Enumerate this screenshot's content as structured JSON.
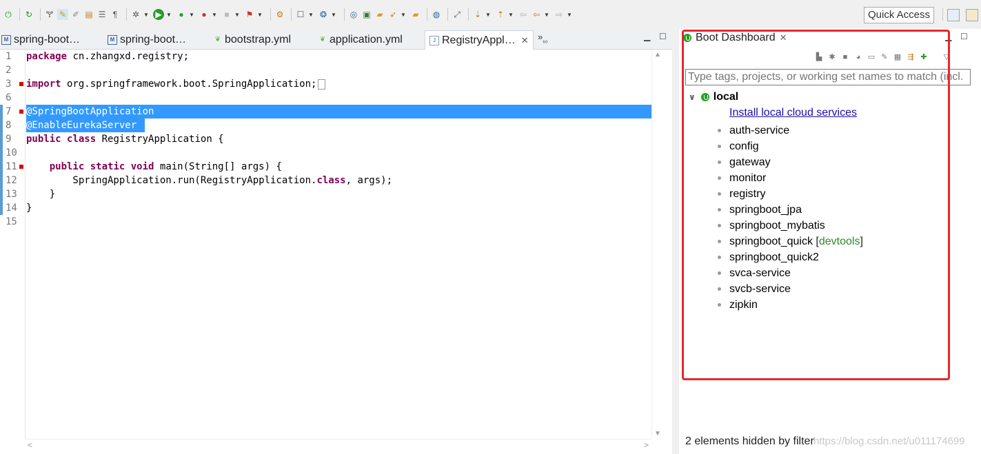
{
  "toolbar": {
    "icons": [
      "spring-boot-icon",
      "new-icon",
      "link-icon",
      "pen-icon",
      "edit-icon",
      "doc-icon",
      "pilcrow-icon",
      "debug-icon",
      "run-icon",
      "coverage-icon",
      "external-tools-icon",
      "stop-icon",
      "stop-red-icon",
      "open-type-icon",
      "new-java-icon",
      "new-class-icon",
      "browse-icon",
      "open-folder-icon",
      "rocket-icon",
      "folder-open-icon",
      "globe-icon",
      "search-icon",
      "next-annotation-icon",
      "prev-annotation-icon",
      "back-icon",
      "forward-icon"
    ],
    "quick_access": "Quick Access"
  },
  "editor_tabs": [
    {
      "label": "spring-boot…",
      "icon": "maven-pom-icon"
    },
    {
      "label": "spring-boot…",
      "icon": "maven-pom-icon"
    },
    {
      "label": "bootstrap.yml",
      "icon": "yaml-leaf-icon"
    },
    {
      "label": "application.yml",
      "icon": "yaml-leaf-icon"
    },
    {
      "label": "RegistryAppl…",
      "icon": "java-file-icon",
      "close": "✕"
    }
  ],
  "editor_overflow": "»",
  "editor_overflow_count": "₆₀",
  "code": {
    "line_numbers": [
      "1",
      "2",
      "3",
      "6",
      "7",
      "8",
      "9",
      "10",
      "11",
      "12",
      "13",
      "14",
      "15"
    ],
    "line1_kw": "package",
    "line1_rest": " cn.zhangxd.registry;",
    "line3_kw": "import",
    "line3_rest": " org.springframework.boot.SpringApplication;",
    "line7": "@SpringBootApplication",
    "line8": "@EnableEurekaServer",
    "line9_kw1": "public",
    "line9_kw2": "class",
    "line9_rest": " RegistryApplication {",
    "line11_indent": "    ",
    "line11_kw1": "public",
    "line11_kw2": "static",
    "line11_kw3": "void",
    "line11_rest": " main(String[] args) {",
    "line12_pre": "        SpringApplication.run(RegistryApplication.",
    "line12_kw": "class",
    "line12_post": ", args);",
    "line13": "    }",
    "line14": "}"
  },
  "dashboard": {
    "title": "Boot Dashboard",
    "close": "✕",
    "filter_placeholder": "Type tags, projects, or working set names to match (incl.",
    "root": "local",
    "install_link": "Install local cloud services",
    "apps": [
      {
        "name": "auth-service"
      },
      {
        "name": "config"
      },
      {
        "name": "gateway"
      },
      {
        "name": "monitor"
      },
      {
        "name": "registry"
      },
      {
        "name": "springboot_jpa"
      },
      {
        "name": "springboot_mybatis"
      },
      {
        "name": "springboot_quick",
        "tag": "devtools"
      },
      {
        "name": "springboot_quick2"
      },
      {
        "name": "svca-service"
      },
      {
        "name": "svcb-service"
      },
      {
        "name": "zipkin"
      }
    ],
    "hidden_note": "2 elements hidden by filter",
    "tools": [
      "start-icon",
      "debug-start-icon",
      "stop-icon",
      "open-browser-icon",
      "console-icon",
      "edit-icon",
      "properties-icon",
      "collapse-icon",
      "add-icon"
    ]
  },
  "watermark": "https://blog.csdn.net/u011174699",
  "colors": {
    "keyword": "#7f0055",
    "selection": "#3399ff",
    "highlight_box": "#e8262b",
    "tag": "#2a8a2a",
    "spring_green": "#22a022"
  }
}
